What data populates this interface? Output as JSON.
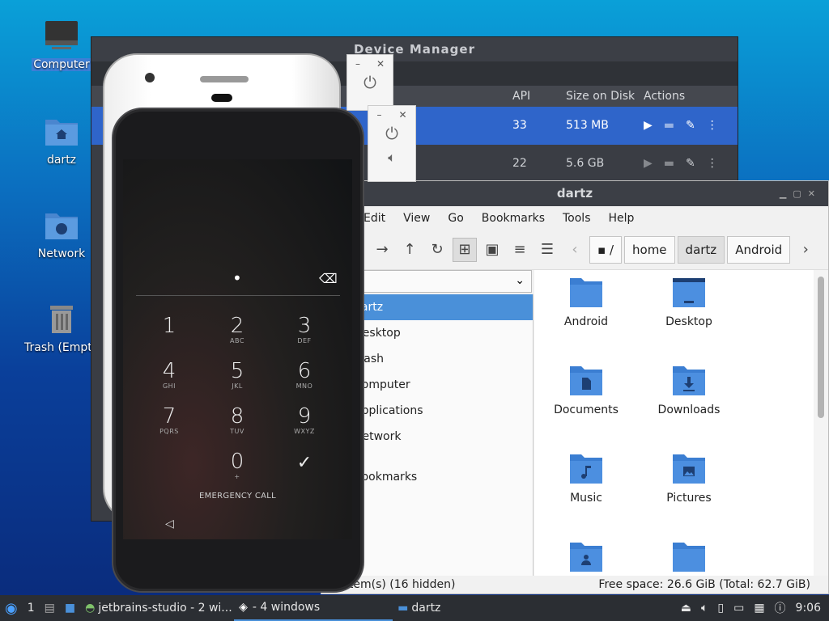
{
  "desktop": {
    "icons": [
      {
        "label": "Computer",
        "icon": "computer-icon"
      },
      {
        "label": "dartz",
        "icon": "home-folder-icon"
      },
      {
        "label": "Network",
        "icon": "network-folder-icon"
      },
      {
        "label": "Trash (Empty)",
        "icon": "trash-icon"
      }
    ]
  },
  "device_manager": {
    "title": "Device Manager",
    "columns": [
      "API",
      "Size on Disk",
      "Actions"
    ],
    "rows": [
      {
        "api": "33",
        "size": "513 MB",
        "selected": true
      },
      {
        "api": "22",
        "size": "5.6 GB",
        "selected": false
      }
    ]
  },
  "file_manager": {
    "title": "dartz",
    "menu": [
      "Edit",
      "View",
      "Go",
      "Bookmarks",
      "Tools",
      "Help"
    ],
    "breadcrumbs": [
      "/",
      "home",
      "dartz",
      "Android"
    ],
    "sidebar": [
      "dartz",
      "Desktop",
      "Trash",
      "Computer",
      "Applications",
      "Network",
      "Bookmarks"
    ],
    "folders": [
      {
        "name": "Android",
        "icon": "folder-icon"
      },
      {
        "name": "Desktop",
        "icon": "desktop-folder-icon"
      },
      {
        "name": "Documents",
        "icon": "documents-folder-icon"
      },
      {
        "name": "Downloads",
        "icon": "downloads-folder-icon"
      },
      {
        "name": "Music",
        "icon": "music-folder-icon"
      },
      {
        "name": "Pictures",
        "icon": "pictures-folder-icon"
      },
      {
        "name": "",
        "icon": "public-folder-icon"
      },
      {
        "name": "",
        "icon": "folder-icon"
      }
    ],
    "status_left": "item(s) (16 hidden)",
    "status_right": "Free space: 26.6 GiB (Total: 62.7 GiB)"
  },
  "emulator": {
    "pin_dot": "•",
    "keys": [
      {
        "num": "1",
        "sub": ""
      },
      {
        "num": "2",
        "sub": "ABC"
      },
      {
        "num": "3",
        "sub": "DEF"
      },
      {
        "num": "4",
        "sub": "GHI"
      },
      {
        "num": "5",
        "sub": "JKL"
      },
      {
        "num": "6",
        "sub": "MNO"
      },
      {
        "num": "7",
        "sub": "PQRS"
      },
      {
        "num": "8",
        "sub": "TUV"
      },
      {
        "num": "9",
        "sub": "WXYZ"
      },
      {
        "num": "0",
        "sub": "+"
      }
    ],
    "emergency": "EMERGENCY CALL"
  },
  "taskbar": {
    "workspace": "1",
    "items": [
      {
        "label": "jetbrains-studio - 2 wi..."
      },
      {
        "label": "- 4 windows"
      },
      {
        "label": "dartz"
      }
    ],
    "clock": "9:06"
  }
}
